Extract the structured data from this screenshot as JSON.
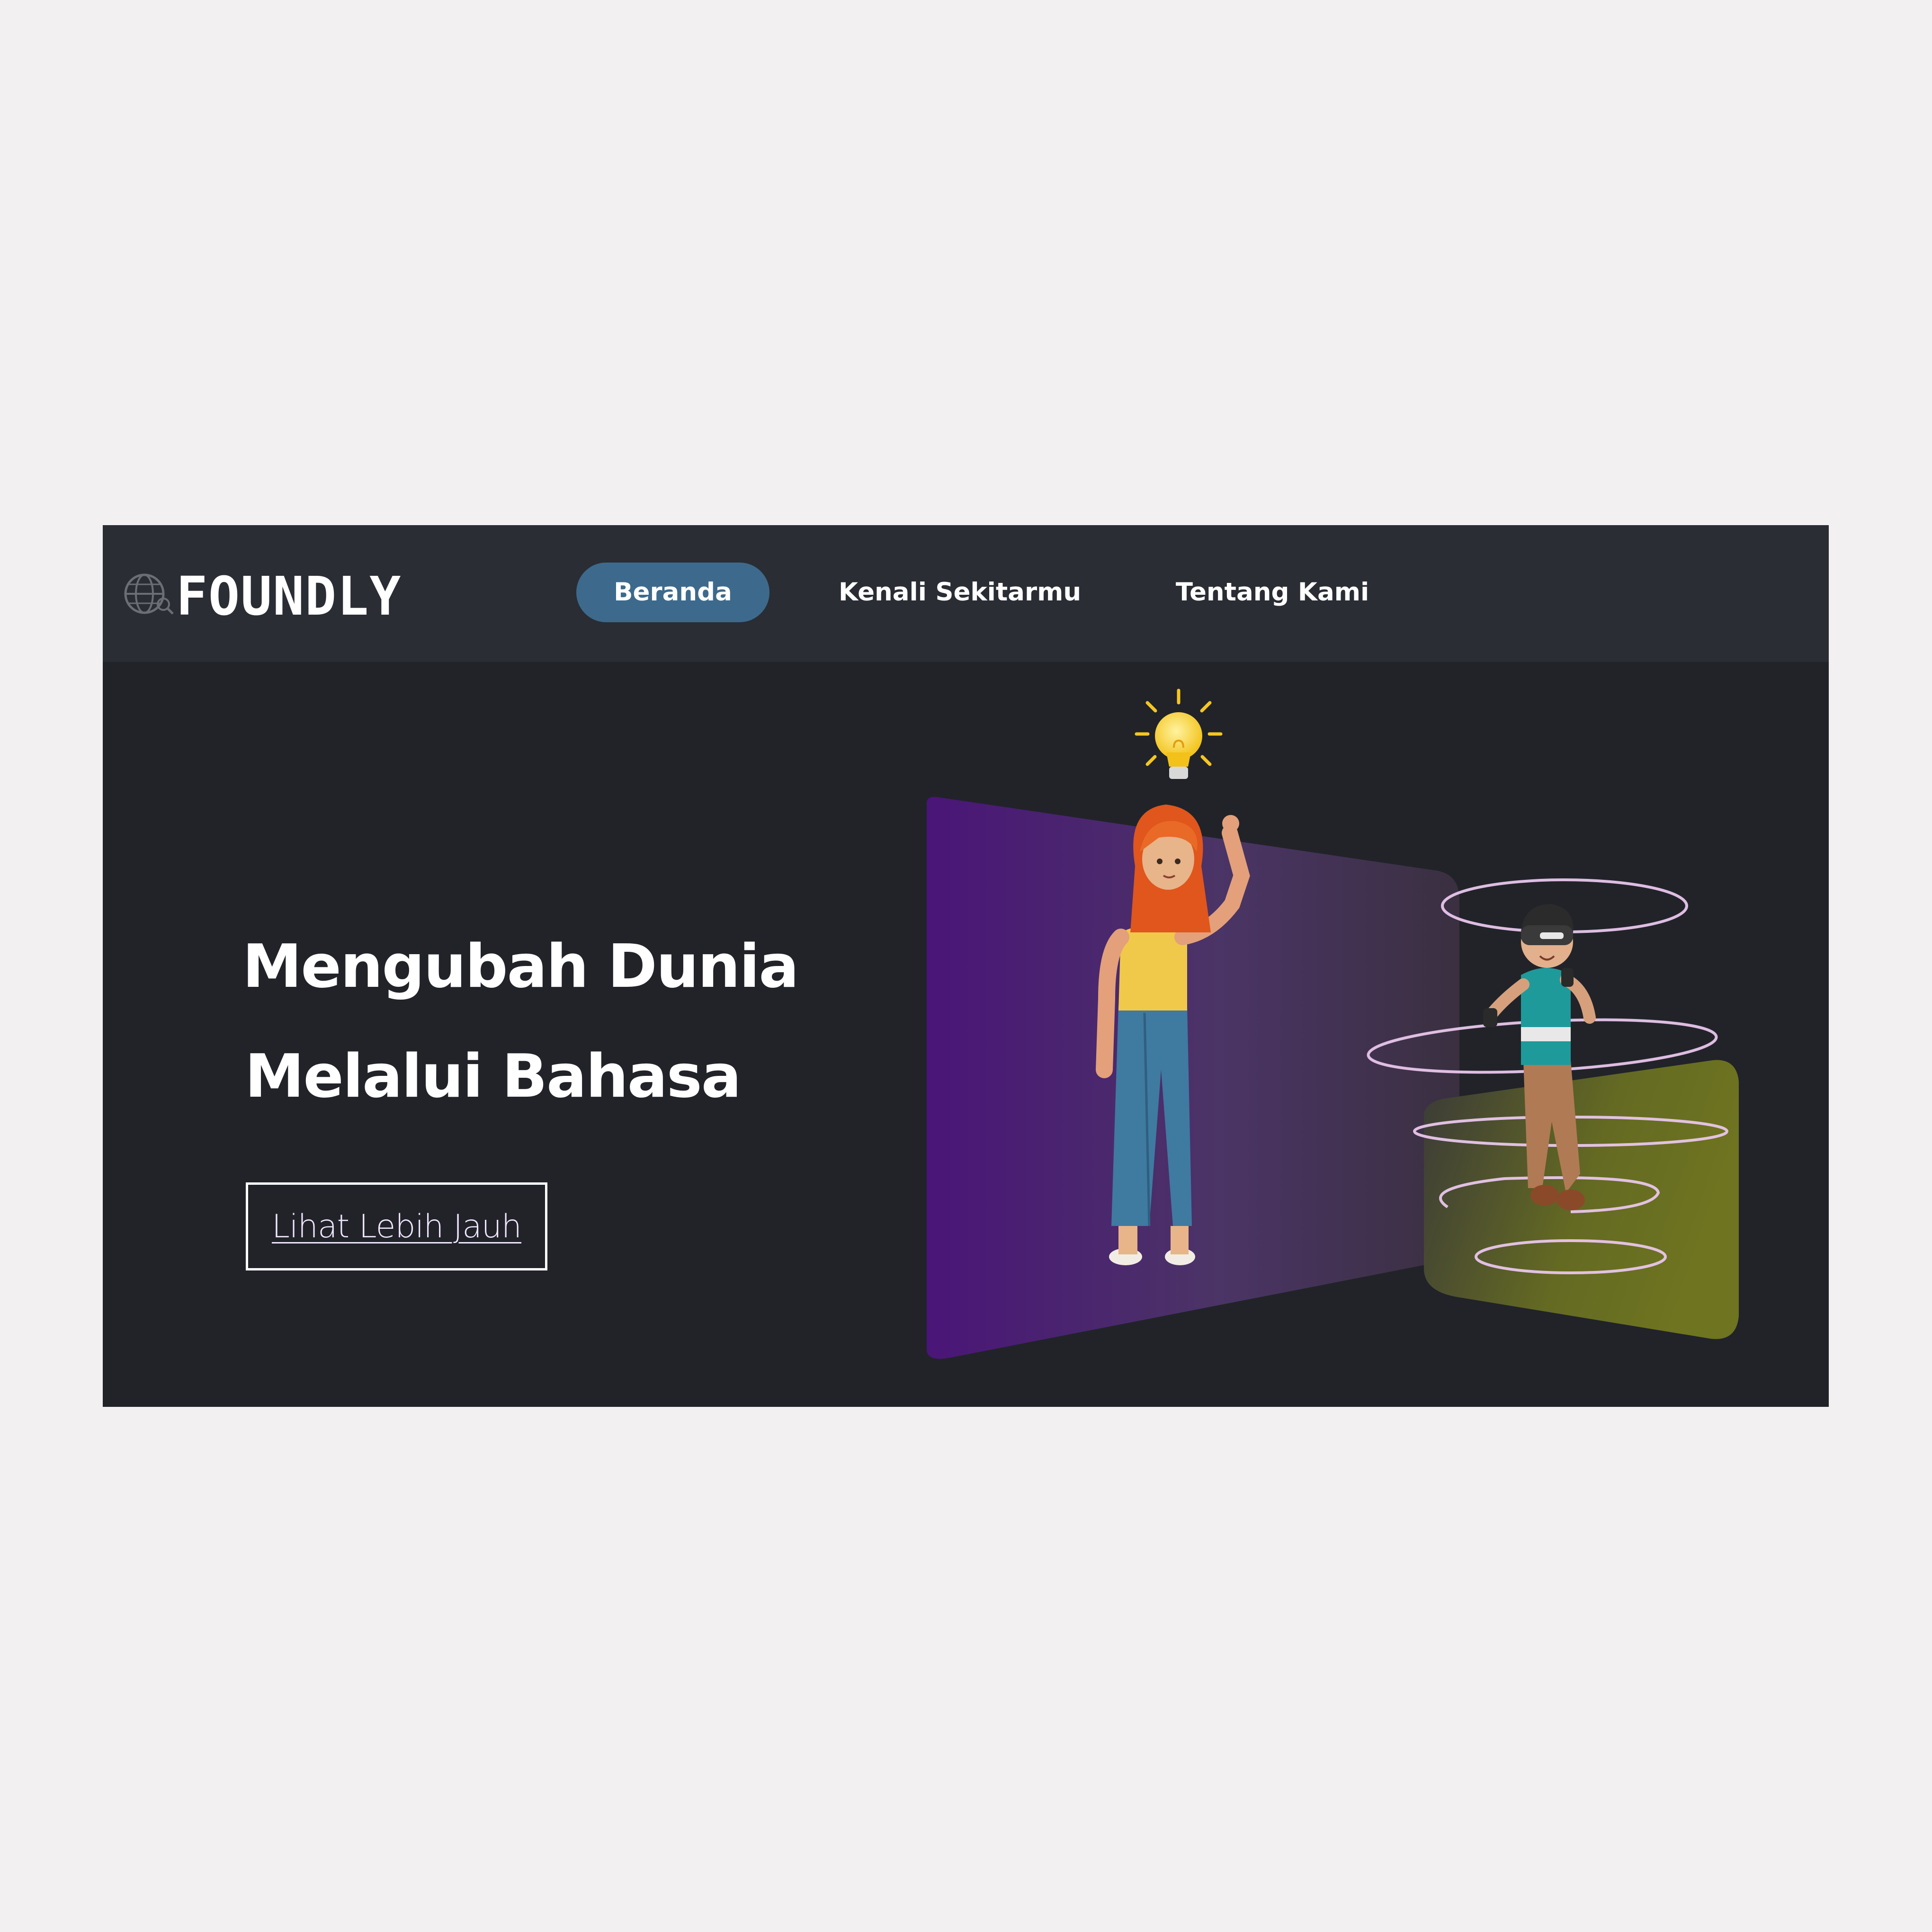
{
  "brand": {
    "name": "FOUNDLY",
    "logo_icon": "globe-magnifier-icon"
  },
  "nav": {
    "items": [
      {
        "label": "Beranda",
        "active": true
      },
      {
        "label": "Kenali Sekitarmu",
        "active": false
      },
      {
        "label": "Tentang Kami",
        "active": false
      }
    ]
  },
  "hero": {
    "title_line1": "Mengubah Dunia",
    "title_line2": "Melalui Bahasa",
    "cta_label": "Lihat Lebih Jauh"
  },
  "colors": {
    "page_background": "#f2f0f1",
    "navbar": "#2a2d34",
    "hero_background": "#212329",
    "active_nav_pill": "#3d6a8c",
    "purple_panel": "#4a1c78",
    "olive_panel": "#6b7020"
  },
  "illustration": {
    "icons": [
      "lightbulb-icon",
      "woman-figure",
      "vr-boy-figure",
      "purple-panel",
      "olive-panel",
      "orbit-rings"
    ]
  }
}
